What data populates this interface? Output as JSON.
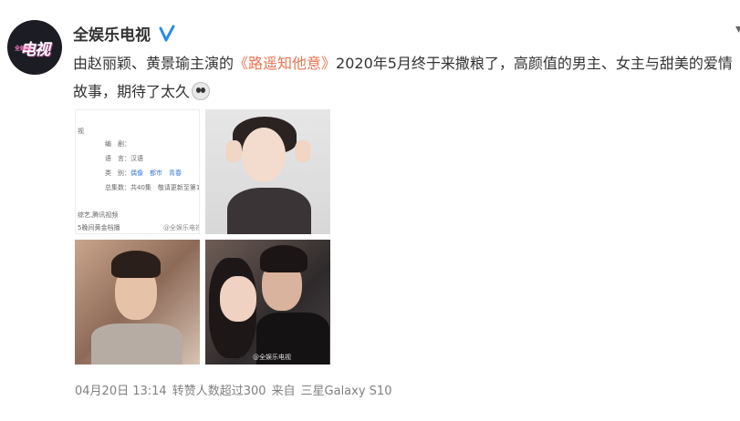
{
  "post": {
    "author": "全娱乐电视",
    "avatar_text": "电视",
    "avatar_small": "全娱乐",
    "text_before": "由赵丽颖、黄景瑜主演的",
    "topic": "《路遥知他意》",
    "text_after": "2020年5月终于来撒粮了，高颜值的男主、女主与甜美的爱情故事，期待了太久",
    "emoji": "face-emoji"
  },
  "photos": {
    "doc_lines": [
      {
        "label": "编　剧：",
        "value": ""
      },
      {
        "label": "语　言：",
        "value": "汉语"
      },
      {
        "label": "类　别：",
        "value": "偶像　都市　青春"
      },
      {
        "label": "总集数：",
        "value": "共40集　敬请更新至第1"
      }
    ],
    "doc_top": "视",
    "doc_platforms": "综艺,腾讯视频",
    "doc_footer": "5晚间黄金档播",
    "doc_watermark": "@全娱乐电视",
    "photo4_watermark": "@全娱乐电视"
  },
  "meta": {
    "date": "04月20日 13:14",
    "reposts": "转赞人数超过300",
    "source_prefix": "来自",
    "device": "三星Galaxy S10"
  },
  "colors": {
    "topic_link": "#eb7350",
    "meta_gray": "#808080",
    "verified_blue": "#2b8ae8"
  }
}
